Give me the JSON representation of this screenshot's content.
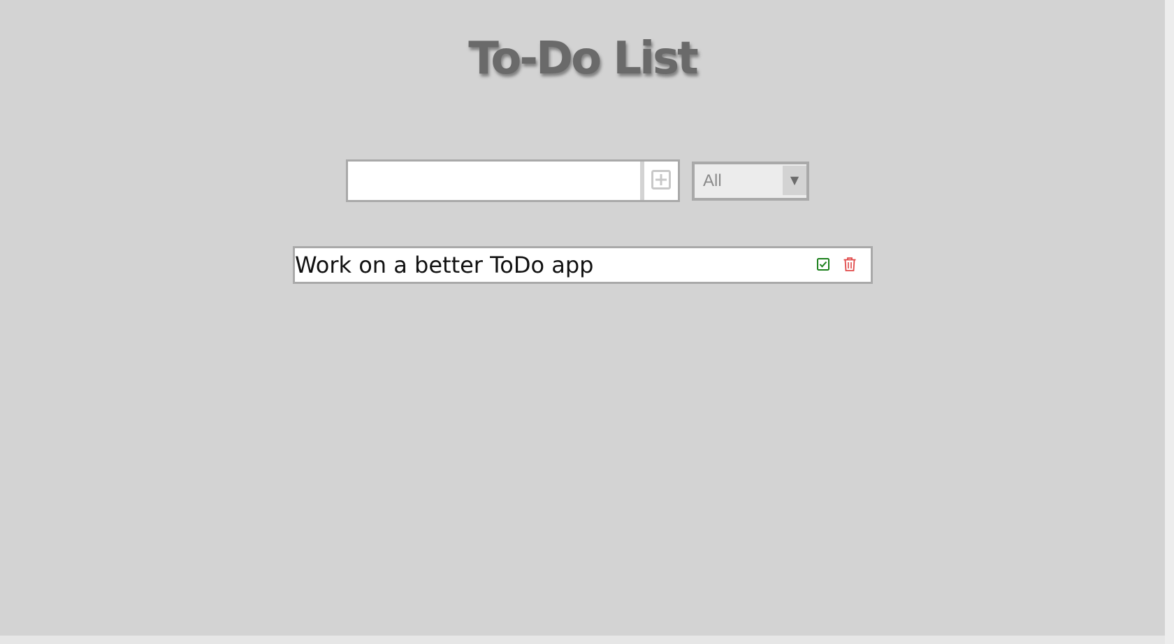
{
  "header": {
    "title": "To-Do List"
  },
  "form": {
    "input_value": "",
    "input_placeholder": "",
    "add_icon": "plus-square-icon"
  },
  "filter": {
    "selected": "All",
    "arrow": "▼"
  },
  "todos": [
    {
      "text": "Work on a better ToDo app",
      "complete_icon": "check-square-icon",
      "delete_icon": "trash-icon"
    }
  ],
  "colors": {
    "background": "#d3d3d3",
    "border": "#a9a9a9",
    "title": "#6a6a6a",
    "complete": "#1a7f1a",
    "delete": "#e04848"
  }
}
